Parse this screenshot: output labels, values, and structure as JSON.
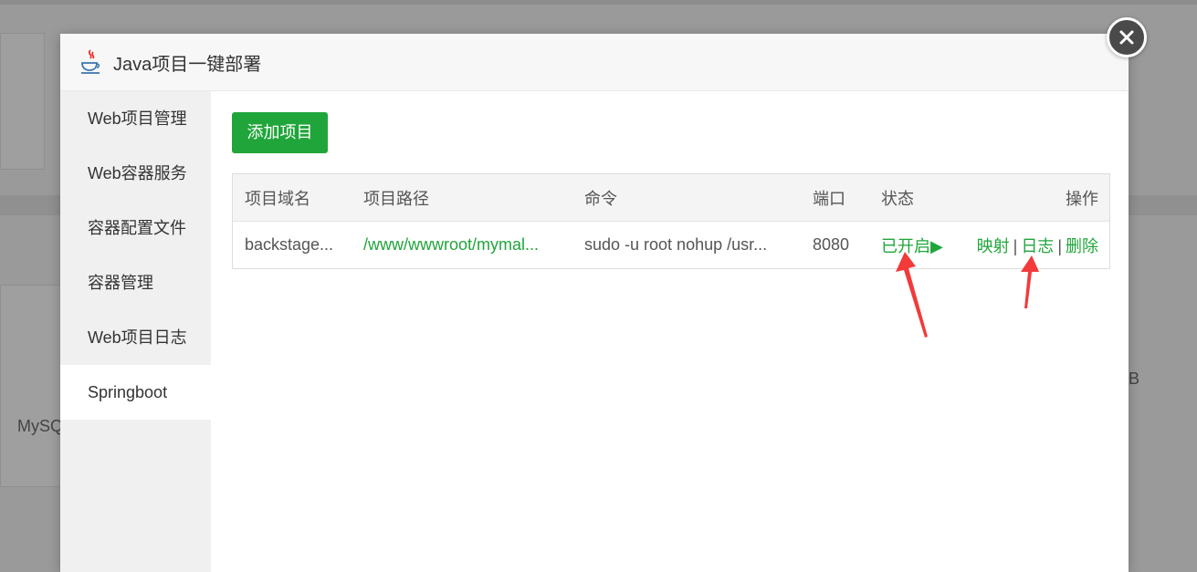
{
  "background": {
    "partial_text_left": "MySQ",
    "partial_text_right": "B"
  },
  "modal": {
    "title": "Java项目一键部署",
    "icon": "java-icon"
  },
  "sidebar": {
    "items": [
      {
        "label": "Web项目管理"
      },
      {
        "label": "Web容器服务"
      },
      {
        "label": "容器配置文件"
      },
      {
        "label": "容器管理"
      },
      {
        "label": "Web项目日志"
      },
      {
        "label": "Springboot",
        "active": true
      }
    ]
  },
  "toolbar": {
    "add_label": "添加项目"
  },
  "table": {
    "headers": [
      "项目域名",
      "项目路径",
      "命令",
      "端口",
      "状态",
      "操作"
    ],
    "rows": [
      {
        "domain": "backstage...",
        "path": "/www/wwwroot/mymal...",
        "command": "sudo -u root nohup /usr...",
        "port": "8080",
        "status": "已开启▶",
        "actions": [
          "映射",
          "日志",
          "删除"
        ],
        "separator": "|"
      }
    ]
  },
  "colors": {
    "accent": "#20a53a",
    "arrow": "#f23a3a"
  }
}
